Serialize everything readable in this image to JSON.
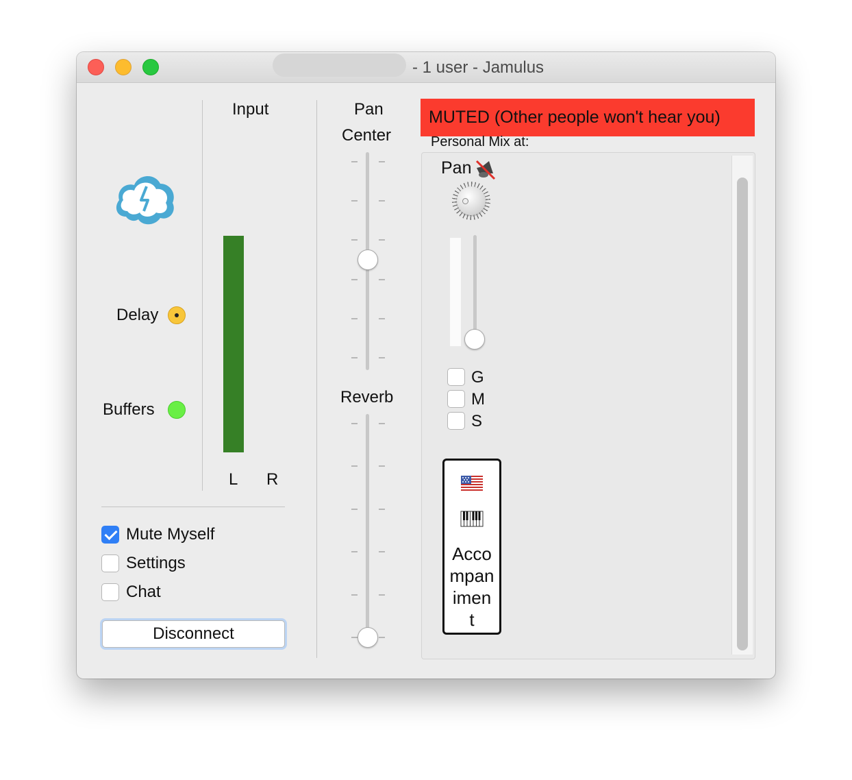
{
  "window": {
    "title": "- 1 user - Jamulus"
  },
  "left": {
    "logo_icon": "jamulus-cloud-logo-icon",
    "delay_label": "Delay",
    "buffers_label": "Buffers",
    "delay_led_color": "#f8c63a",
    "buffers_led_color": "#69ef45"
  },
  "input_meter": {
    "title": "Input",
    "left_label": "L",
    "right_label": "R",
    "meter_color": "#368026"
  },
  "controls": {
    "mute_myself": {
      "label": "Mute Myself",
      "checked": true
    },
    "settings": {
      "label": "Settings",
      "checked": false
    },
    "chat": {
      "label": "Chat",
      "checked": false
    },
    "disconnect_label": "Disconnect"
  },
  "pan": {
    "title_line1": "Pan",
    "title_line2": "Center"
  },
  "reverb": {
    "title": "Reverb"
  },
  "mixer": {
    "muted_banner": "MUTED (Other people won't hear you)",
    "personal_mix_label": "Personal Mix at:",
    "channel": {
      "pan_label": "Pan",
      "mute_icon": "speaker-muted-icon",
      "group_label": "G",
      "mute_label": "M",
      "solo_label": "S",
      "flag_icon": "us-flag-icon",
      "instrument_icon": "keyboard-icon",
      "name": "Acco\nmpan\nimen\nt"
    }
  }
}
